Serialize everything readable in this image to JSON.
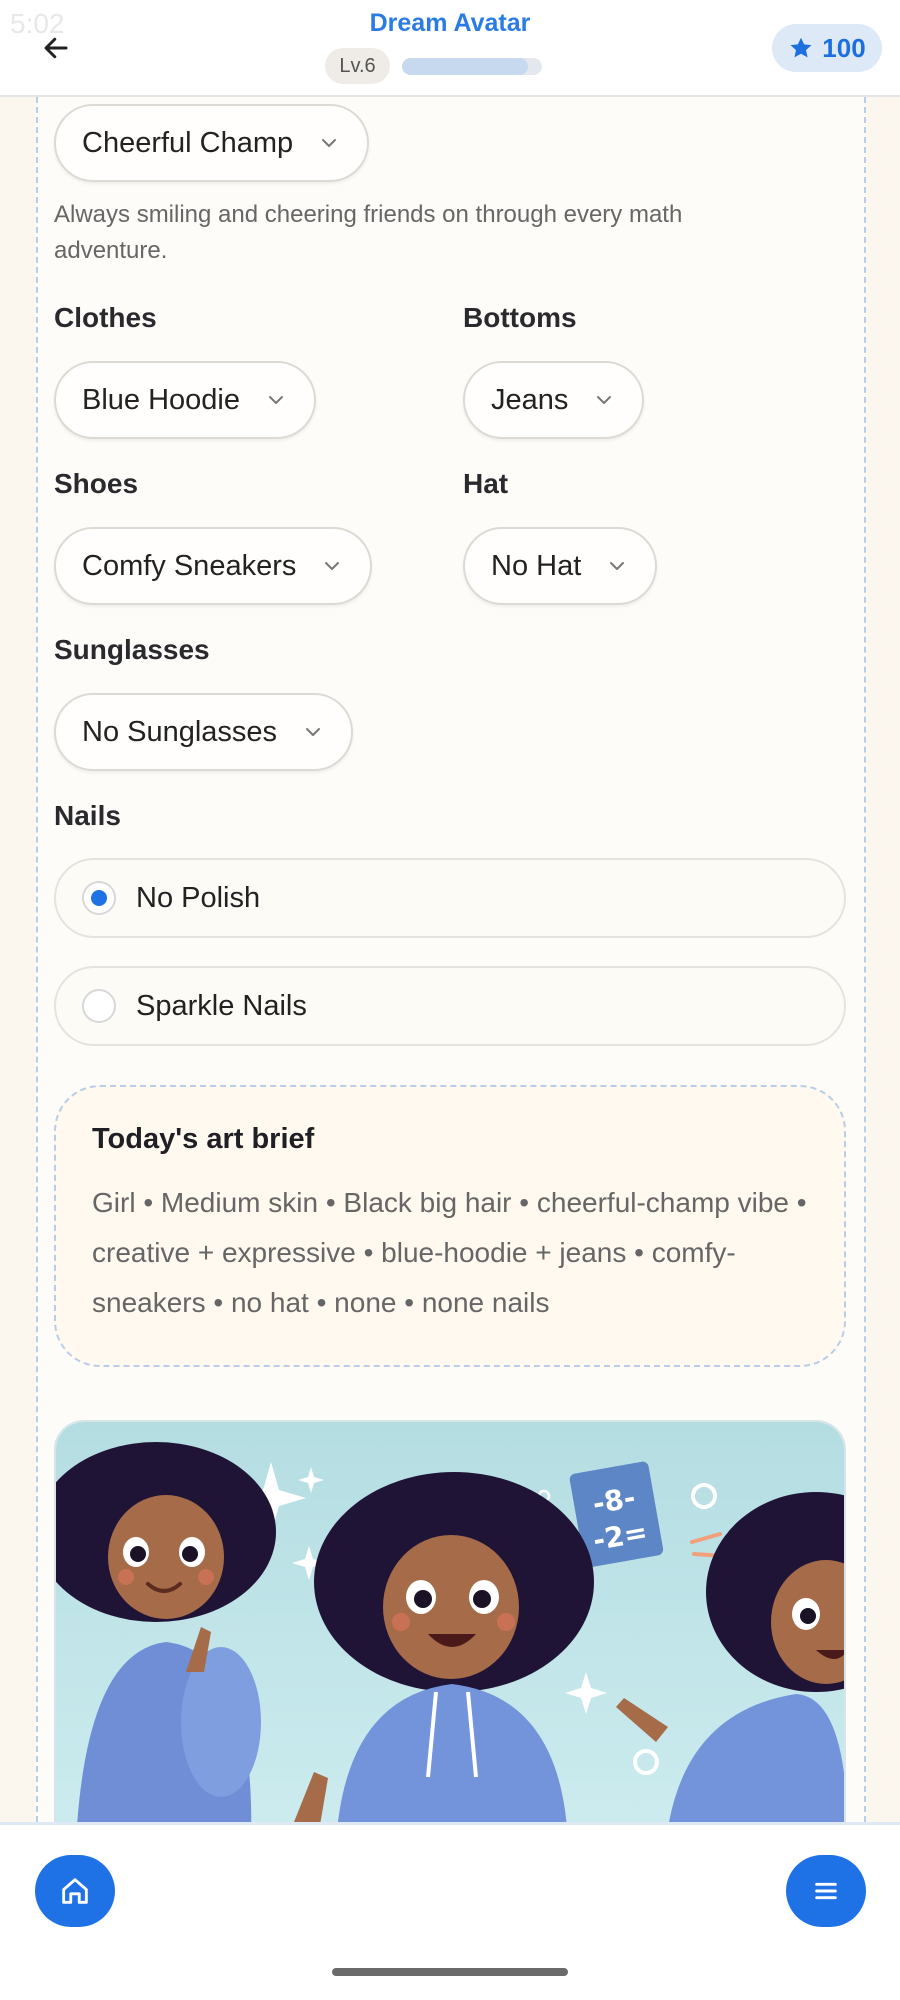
{
  "status": {
    "time": "5:02"
  },
  "header": {
    "title": "Dream Avatar",
    "level": "Lv.6",
    "level_progress": 0.9,
    "stars": "100",
    "accent": "#2a7be3"
  },
  "personality": {
    "selected": "Cheerful Champ",
    "description": "Always smiling and cheering friends on through every math adventure."
  },
  "outfit": {
    "clothes": {
      "label": "Clothes",
      "value": "Blue Hoodie"
    },
    "bottoms": {
      "label": "Bottoms",
      "value": "Jeans"
    },
    "shoes": {
      "label": "Shoes",
      "value": "Comfy Sneakers"
    },
    "hat": {
      "label": "Hat",
      "value": "No Hat"
    },
    "sunglasses": {
      "label": "Sunglasses",
      "value": "No Sunglasses"
    }
  },
  "nails": {
    "label": "Nails",
    "options": [
      {
        "label": "No Polish",
        "selected": true
      },
      {
        "label": "Sparkle Nails",
        "selected": false
      }
    ]
  },
  "brief": {
    "title": "Today's art brief",
    "text": "Girl • Medium skin • Black big hair • cheerful-champ vibe • creative + expressive • blue-hoodie + jeans • comfy-sneakers • no hat • none • none nails"
  },
  "art": {
    "board_line1": "-8-",
    "board_line2": "-2="
  },
  "icons": {
    "back": "arrow-left-icon",
    "star": "star-icon",
    "chevron": "chevron-down-icon",
    "home": "home-icon",
    "menu": "menu-icon"
  }
}
